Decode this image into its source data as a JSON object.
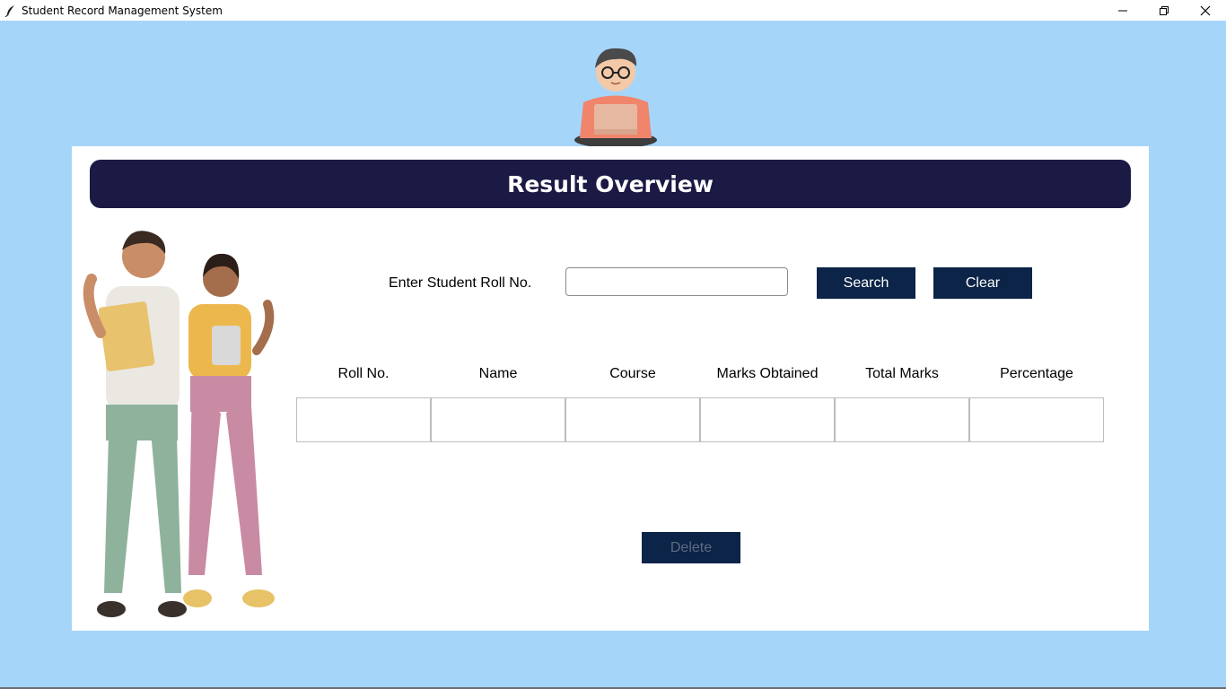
{
  "window": {
    "title": "Student Record Management System",
    "controls": [
      "minimize-icon",
      "restore-icon",
      "close-icon"
    ]
  },
  "header": {
    "title": "Result Overview"
  },
  "search": {
    "label": "Enter Student Roll No.",
    "value": "",
    "search_label": "Search",
    "clear_label": "Clear"
  },
  "table": {
    "columns": [
      "Roll No.",
      "Name",
      "Course",
      "Marks Obtained",
      "Total Marks",
      "Percentage"
    ],
    "rows": [
      [
        "",
        "",
        "",
        "",
        "",
        ""
      ]
    ]
  },
  "actions": {
    "delete_label": "Delete"
  },
  "colors": {
    "background": "#a6d5fa",
    "card": "#ffffff",
    "header_bar": "#1b1a45",
    "button": "#0b2447",
    "disabled_text": "#5d6b80"
  }
}
